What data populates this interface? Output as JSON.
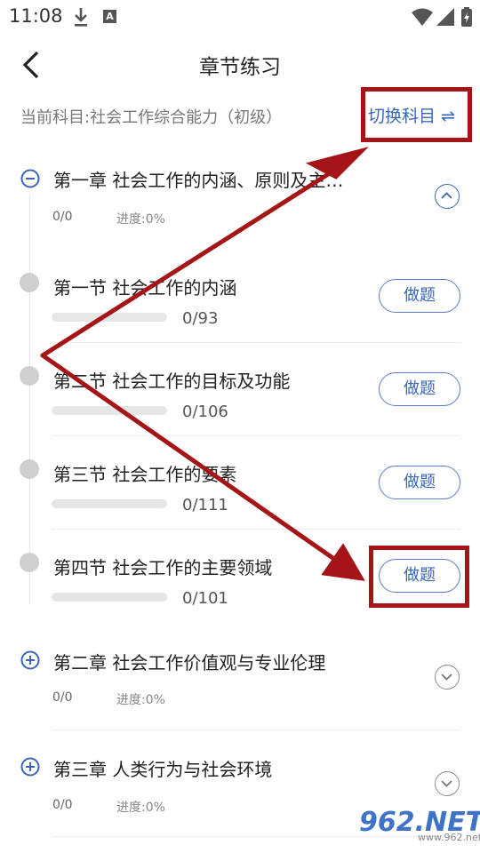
{
  "status": {
    "time": "11:08",
    "badge": "A"
  },
  "header": {
    "title": "章节练习",
    "subject": "当前科目:社会工作综合能力（初级）",
    "switch_label": "切换科目 ⇌"
  },
  "chapters": [
    {
      "title": "第一章 社会工作的内涵、原则及主…",
      "count": "0/0",
      "progress": "进度:0%",
      "expanded": true
    },
    {
      "title": "第二章 社会工作价值观与专业伦理",
      "count": "0/0",
      "progress": "进度:0%",
      "expanded": false
    },
    {
      "title": "第三章 人类行为与社会环境",
      "count": "0/0",
      "progress": "进度:0%",
      "expanded": false
    }
  ],
  "sections": [
    {
      "title": "第一节 社会工作的内涵",
      "count": "0/93",
      "button": "做题",
      "progress_fraction": 0
    },
    {
      "title": "第二节 社会工作的目标及功能",
      "count": "0/106",
      "button": "做题",
      "progress_fraction": 0
    },
    {
      "title": "第三节 社会工作的要素",
      "count": "0/111",
      "button": "做题",
      "progress_fraction": 0
    },
    {
      "title": "第四节 社会工作的主要领域",
      "count": "0/101",
      "button": "做题",
      "progress_fraction": 0
    }
  ],
  "watermark": {
    "brand": "962.NET",
    "url": "www.962.net"
  },
  "colors": {
    "accent": "#3a66b8",
    "annotation": "#a51416"
  }
}
